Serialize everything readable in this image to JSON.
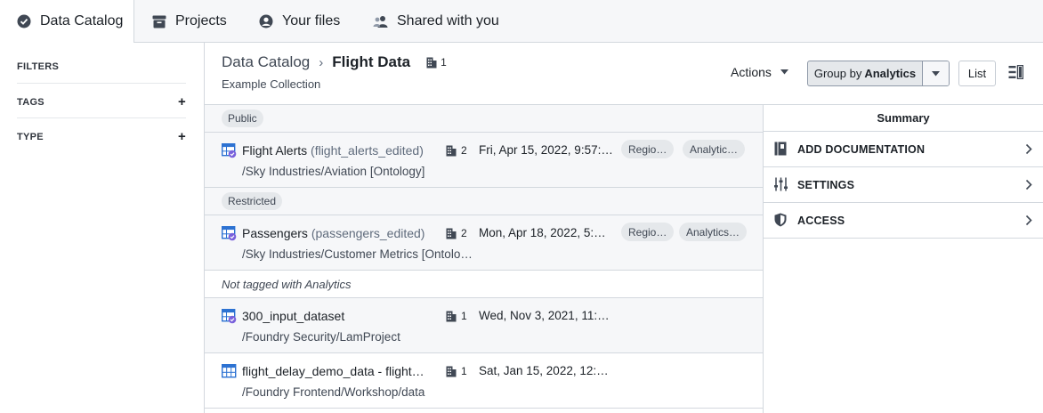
{
  "tabs": [
    {
      "label": "Data Catalog",
      "icon": "check-circle-icon",
      "active": true
    },
    {
      "label": "Projects",
      "icon": "archive-icon",
      "active": false
    },
    {
      "label": "Your files",
      "icon": "user-icon",
      "active": false
    },
    {
      "label": "Shared with you",
      "icon": "people-icon",
      "active": false
    }
  ],
  "sidebar": {
    "filters_label": "FILTERS",
    "tags_label": "TAGS",
    "type_label": "TYPE",
    "add_symbol": "+"
  },
  "header": {
    "breadcrumb_parent": "Data Catalog",
    "breadcrumb_separator": "›",
    "title": "Flight Data",
    "project_count": "1",
    "subtitle": "Example Collection"
  },
  "toolbar": {
    "actions_label": "Actions",
    "group_by_prefix": "Group by",
    "group_by_value": "Analytics",
    "list_label": "List"
  },
  "groups": [
    {
      "label": "Public",
      "style": "pill"
    },
    {
      "label": "Restricted",
      "style": "pill"
    },
    {
      "label": "Not tagged with Analytics",
      "style": "italic"
    }
  ],
  "rows": [
    {
      "name": "Flight Alerts",
      "alias": "(flight_alerts_edited)",
      "path": "/Sky Industries/Aviation [Ontology]",
      "projects": "2",
      "date": "Fri, Apr 15, 2022, 9:57:…",
      "tags": [
        "Regio…",
        "Analytic…"
      ],
      "icon": "dataset-ontology-icon"
    },
    {
      "name": "Passengers",
      "alias": "(passengers_edited)",
      "path": "/Sky Industries/Customer Metrics [Ontolo…",
      "projects": "2",
      "date": "Mon, Apr 18, 2022, 5:…",
      "tags": [
        "Regio…",
        "Analytics…"
      ],
      "icon": "dataset-ontology-icon"
    },
    {
      "name": "300_input_dataset",
      "alias": "",
      "path": "/Foundry Security/LamProject",
      "projects": "1",
      "date": "Wed, Nov 3, 2021, 11:…",
      "tags": [],
      "icon": "dataset-ontology-icon"
    },
    {
      "name": "flight_delay_demo_data - flight…",
      "alias": "",
      "path": "/Foundry Frontend/Workshop/data",
      "projects": "1",
      "date": "Sat, Jan 15, 2022, 12:…",
      "tags": [],
      "icon": "dataset-table-icon"
    }
  ],
  "summary": {
    "title": "Summary",
    "items": [
      {
        "label": "ADD DOCUMENTATION",
        "icon": "documentation-icon"
      },
      {
        "label": "SETTINGS",
        "icon": "settings-sliders-icon"
      },
      {
        "label": "ACCESS",
        "icon": "shield-icon"
      }
    ]
  },
  "colors": {
    "accent_purple": "#7961db",
    "dataset_blue": "#2d72d2",
    "border": "#d3d8de",
    "row_gray": "#f6f7f9"
  }
}
